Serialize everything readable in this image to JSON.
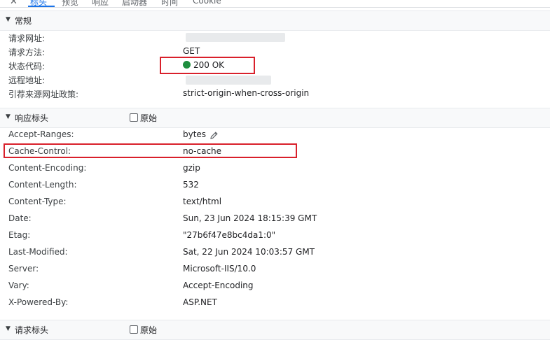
{
  "tabs": {
    "items": [
      "标头",
      "预览",
      "响应",
      "启动器",
      "时间",
      "Cookie"
    ],
    "active_index": 0
  },
  "general": {
    "title": "常规",
    "rows": [
      {
        "name": "请求网址:",
        "value": ""
      },
      {
        "name": "请求方法:",
        "value": "GET"
      },
      {
        "name": "状态代码:",
        "value": "200 OK"
      },
      {
        "name": "远程地址:",
        "value": ""
      },
      {
        "name": "引荐来源网址政策:",
        "value": "strict-origin-when-cross-origin"
      }
    ],
    "status_color": "#1e8e3e"
  },
  "response_headers": {
    "title": "响应标头",
    "raw_label": "原始",
    "raw_checked": false,
    "rows": [
      {
        "name": "Accept-Ranges:",
        "value": "bytes"
      },
      {
        "name": "Cache-Control:",
        "value": "no-cache"
      },
      {
        "name": "Content-Encoding:",
        "value": "gzip"
      },
      {
        "name": "Content-Length:",
        "value": "532"
      },
      {
        "name": "Content-Type:",
        "value": "text/html"
      },
      {
        "name": "Date:",
        "value": "Sun, 23 Jun 2024 18:15:39 GMT"
      },
      {
        "name": "Etag:",
        "value": "\"27b6f47e8bc4da1:0\""
      },
      {
        "name": "Last-Modified:",
        "value": "Sat, 22 Jun 2024 10:03:57 GMT"
      },
      {
        "name": "Server:",
        "value": "Microsoft-IIS/10.0"
      },
      {
        "name": "Vary:",
        "value": "Accept-Encoding"
      },
      {
        "name": "X-Powered-By:",
        "value": "ASP.NET"
      }
    ]
  },
  "request_headers": {
    "title": "请求标头",
    "raw_label": "原始",
    "raw_checked": false
  },
  "colors": {
    "accent": "#1a73e8",
    "highlight": "#d9202b"
  }
}
